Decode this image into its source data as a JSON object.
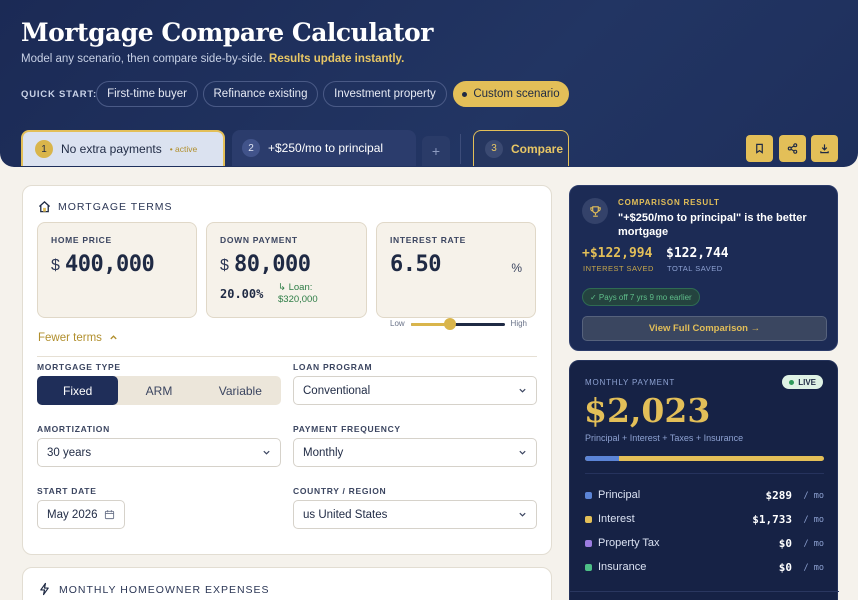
{
  "header": {
    "title": "Mortgage Compare Calculator",
    "subtitle": "Model any scenario, then compare side-by-side.",
    "subtitle_highlight": "Results update instantly.",
    "quick_start_label": "QUICK START:",
    "quick_start": [
      "First-time buyer",
      "Refinance existing",
      "Investment property",
      "Custom scenario"
    ],
    "quick_start_active_index": 3
  },
  "tabs": [
    {
      "num": "1",
      "label": "No extra payments",
      "badge": "• active"
    },
    {
      "num": "2",
      "label": "+$250/mo to principal"
    },
    {
      "num": "3",
      "label": "Compare"
    }
  ],
  "tab_add_label": "+",
  "toolbar": {
    "icons": [
      "bookmark-icon",
      "share-icon",
      "download-icon"
    ]
  },
  "terms": {
    "section_title": "MORTGAGE TERMS",
    "home_price": {
      "label": "HOME PRICE",
      "currency": "$",
      "value": "400,000"
    },
    "down_payment": {
      "label": "DOWN PAYMENT",
      "currency": "$",
      "value": "80,000",
      "percent": "20.00%",
      "loan_note_line1": "↳ Loan:",
      "loan_note_line2": "$320,000"
    },
    "interest_rate": {
      "label": "INTEREST RATE",
      "value": "6.50",
      "unit": "%",
      "slider_low": "Low",
      "slider_high": "High",
      "slider_fraction": 0.42
    },
    "fewer_terms": "Fewer terms",
    "mortgage_type": {
      "label": "MORTGAGE TYPE",
      "options": [
        "Fixed",
        "ARM",
        "Variable"
      ],
      "selected_index": 0
    },
    "loan_program": {
      "label": "LOAN PROGRAM",
      "value": "Conventional"
    },
    "amortization": {
      "label": "AMORTIZATION",
      "value": "30 years"
    },
    "payment_frequency": {
      "label": "PAYMENT FREQUENCY",
      "value": "Monthly"
    },
    "start_date": {
      "label": "START DATE",
      "value": "May 2026"
    },
    "country": {
      "label": "COUNTRY / REGION",
      "value": "us United States"
    }
  },
  "expenses": {
    "section_title": "MONTHLY HOMEOWNER EXPENSES"
  },
  "comparison": {
    "kicker": "COMPARISON RESULT",
    "text": "\"+$250/mo to principal\" is the better mortgage",
    "interest_saved": "+$122,994",
    "interest_saved_label": "INTEREST SAVED",
    "total_saved": "$122,744",
    "total_saved_label": "TOTAL SAVED",
    "payoff_note": "✓ Pays off 7 yrs 9 mo earlier",
    "view_button": "View Full Comparison →"
  },
  "payment": {
    "kicker": "MONTHLY PAYMENT",
    "live": "LIVE",
    "amount": "$2,023",
    "subtitle": "Principal + Interest + Taxes + Insurance",
    "principal_fraction": 0.143,
    "breakdown": [
      {
        "name": "Principal",
        "value": "$289",
        "per": "/ mo",
        "color": "#5b84d6"
      },
      {
        "name": "Interest",
        "value": "$1,733",
        "per": "/ mo",
        "color": "#e3bf58"
      },
      {
        "name": "Property Tax",
        "value": "$0",
        "per": "/ mo",
        "color": "#9b7ce0"
      },
      {
        "name": "Insurance",
        "value": "$0",
        "per": "/ mo",
        "color": "#4dbf86"
      }
    ]
  },
  "colors": {
    "accent": "#e3bf58",
    "navy": "#1b2a55",
    "background": "#f5f2ec"
  }
}
